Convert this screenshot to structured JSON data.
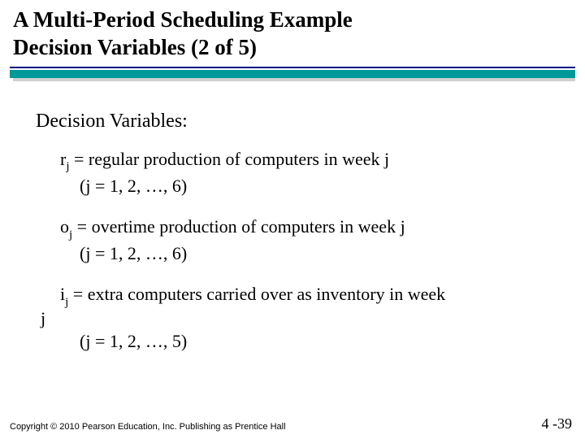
{
  "title": {
    "line1": "A Multi-Period Scheduling Example",
    "line2": "Decision Variables (2 of 5)"
  },
  "section_heading": "Decision Variables:",
  "vars": {
    "r": {
      "sym": "r",
      "sub": "j",
      "desc": " = regular production of computers in week j",
      "range": "(j = 1, 2, …, 6)"
    },
    "o": {
      "sym": "o",
      "sub": "j",
      "desc": " = overtime production of computers in week j",
      "range": "(j = 1, 2, …, 6)"
    },
    "i": {
      "sym": "i",
      "sub": "j",
      "desc": " = extra computers carried over as inventory in week",
      "trail": "j",
      "range": "(j = 1, 2, …, 5)"
    }
  },
  "footer": {
    "copyright": "Copyright © 2010 Pearson Education, Inc. Publishing as Prentice Hall",
    "page": "4 -39"
  }
}
